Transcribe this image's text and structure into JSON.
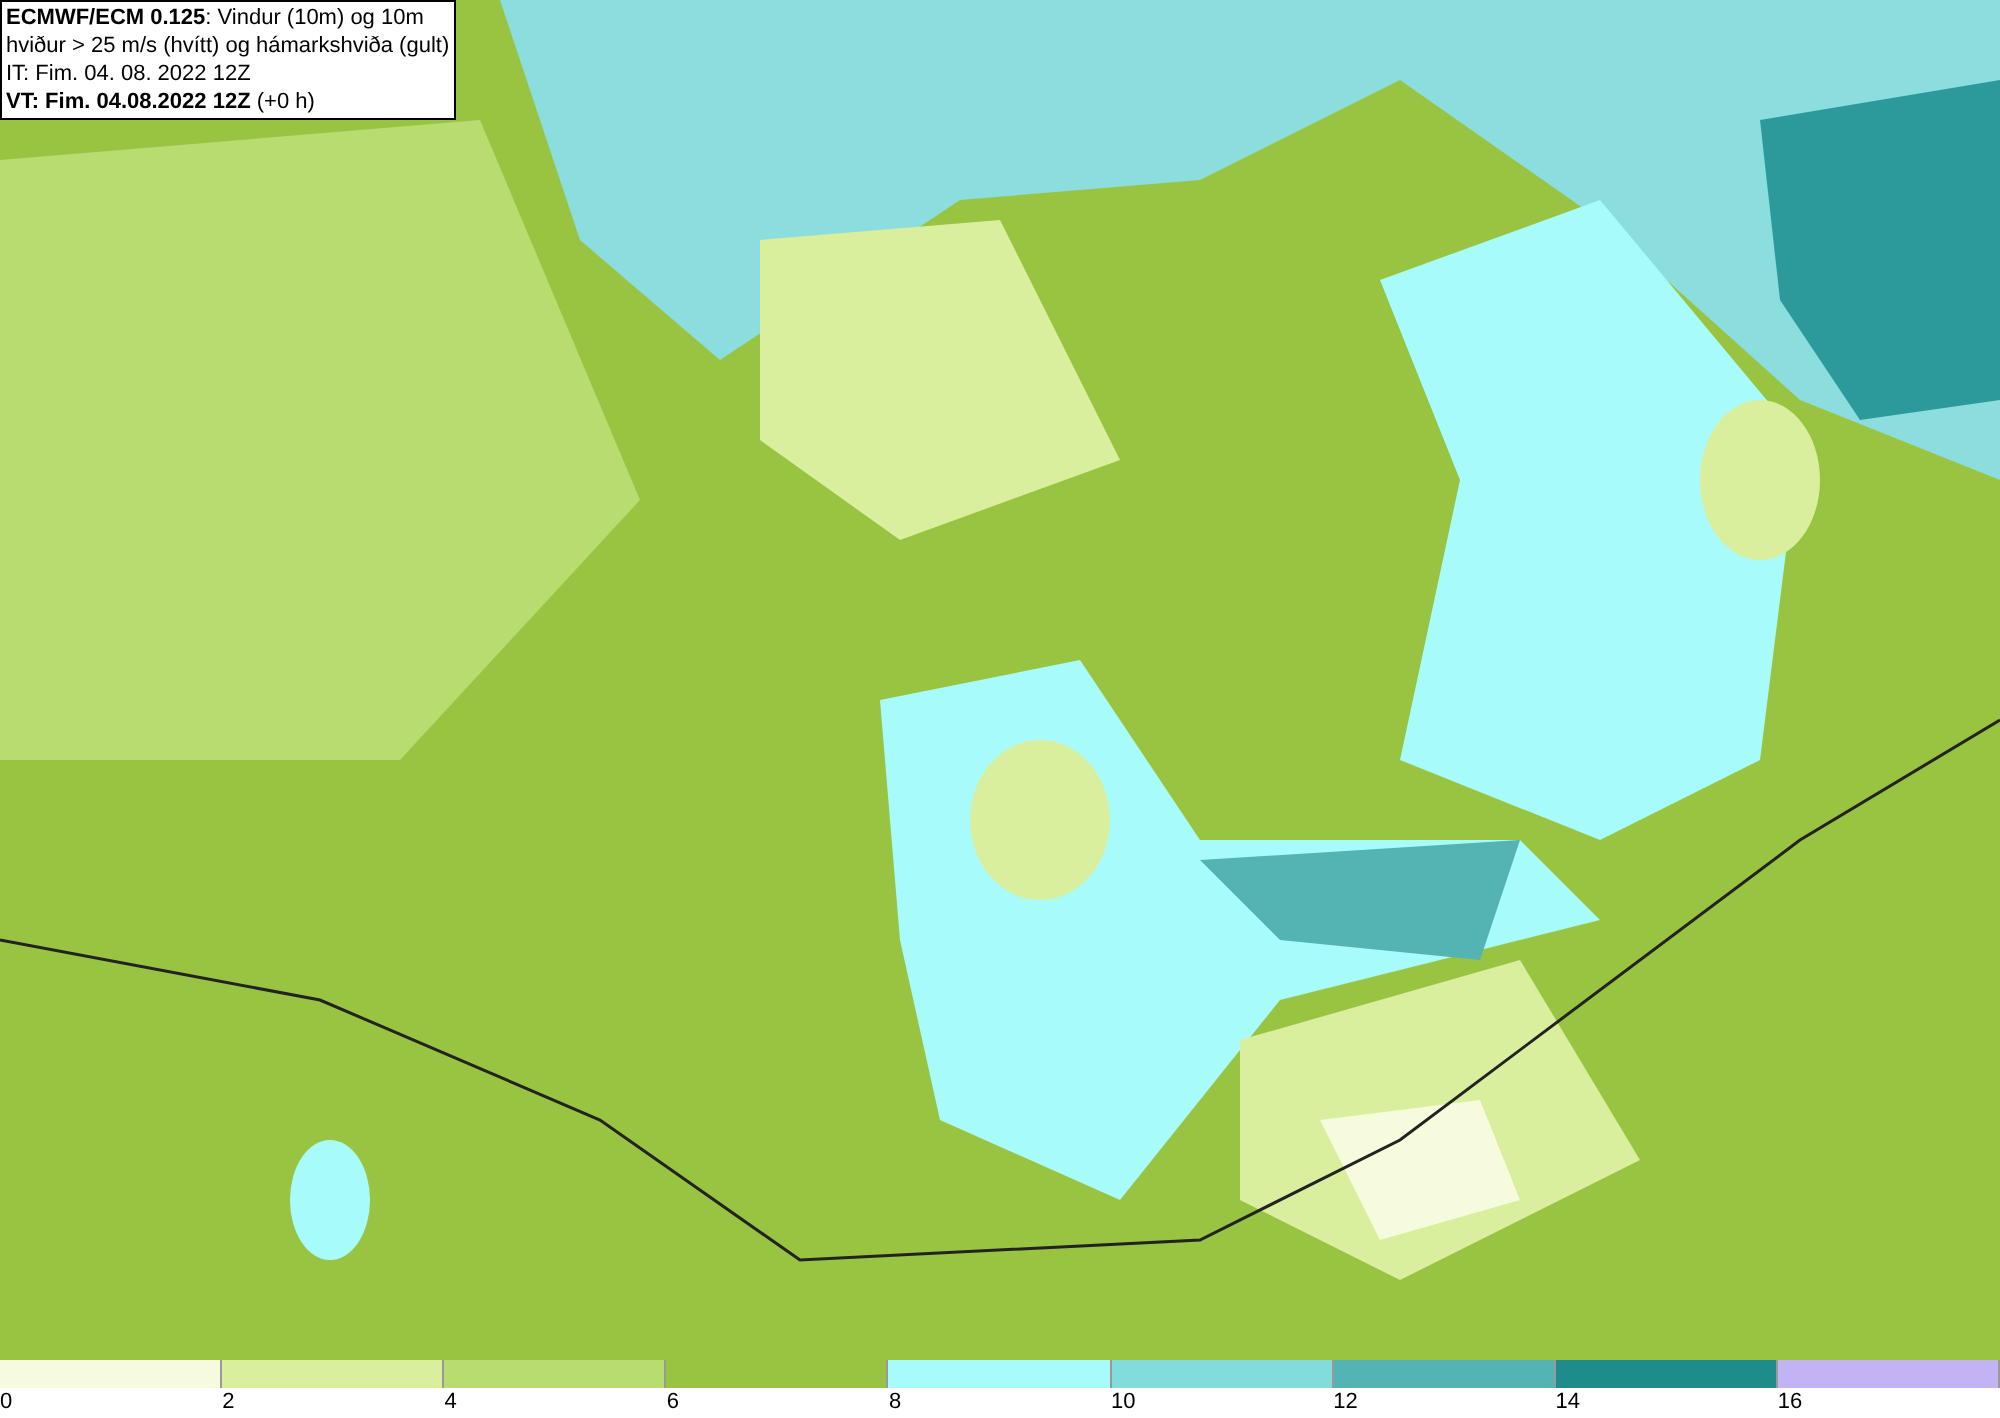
{
  "info_box": {
    "lines": [
      "**ECMWF/ECM 0.125**: Vindur (10m) og 10m",
      "hviður > 25 m/s (hvítt) og hámarkshviða (gult)",
      "IT: Fim. 04. 08. 2022 12Z",
      "**VT: Fim. 04.08.2022 12Z** (+0 h)"
    ]
  },
  "legend": {
    "items": [
      {
        "label": "0",
        "color": "#f5fbdc"
      },
      {
        "label": "2",
        "color": "#d9ef9e"
      },
      {
        "label": "4",
        "color": "#b8dc70"
      },
      {
        "label": "6",
        "color": "#98c441"
      },
      {
        "label": "8",
        "color": "#a8fbfb"
      },
      {
        "label": "10",
        "color": "#82dcdc"
      },
      {
        "label": "12",
        "color": "#54b4b4"
      },
      {
        "label": "14",
        "color": "#1f8c8c"
      },
      {
        "label": "16",
        "color": "#c3b3f5"
      }
    ]
  }
}
